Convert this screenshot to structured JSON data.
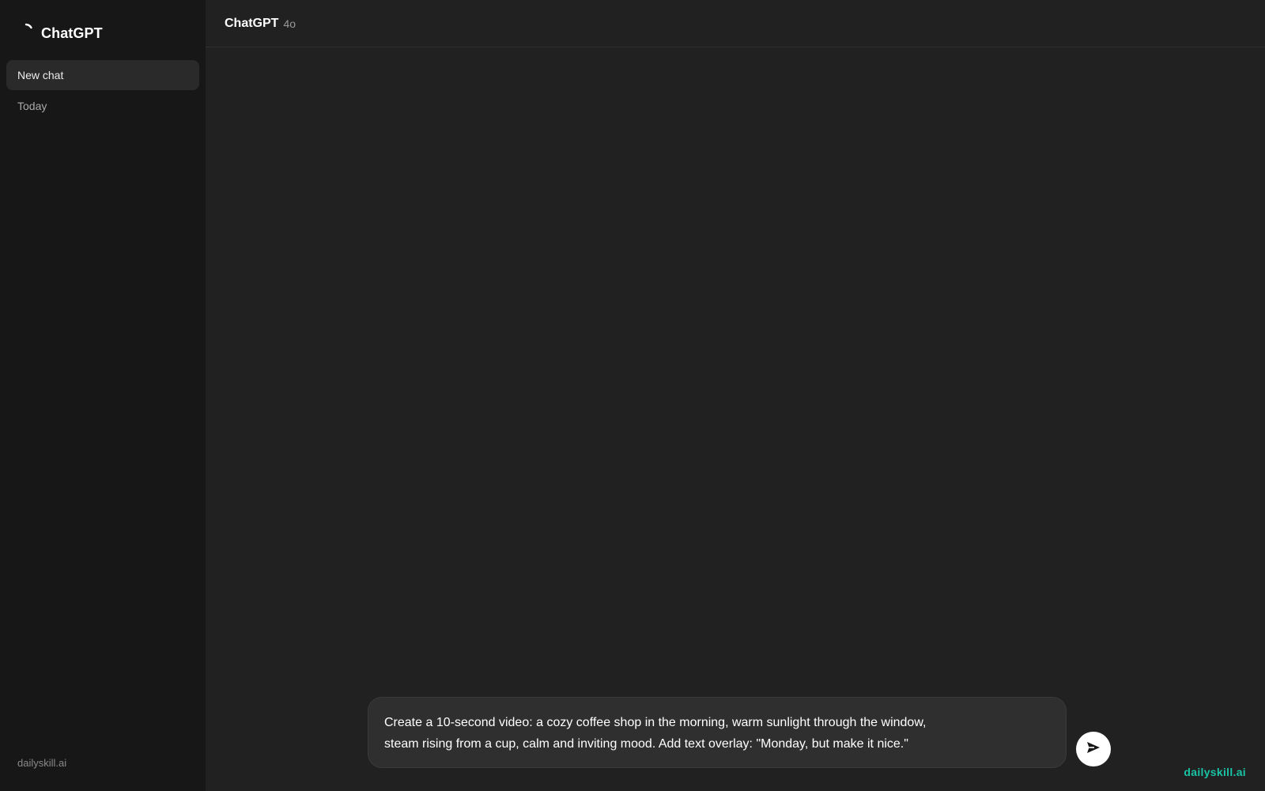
{
  "sidebar": {
    "brand": "ChatGPT",
    "logo_icon": "loading-spinner-icon",
    "new_chat_label": "New chat",
    "section_today": "Today",
    "footer": "dailyskill.ai"
  },
  "header": {
    "title": "ChatGPT",
    "version": "4o"
  },
  "composer": {
    "text": "Create a 10-second video: a cozy coffee shop in the morning, warm sunlight through the window,\nsteam rising from a cup, calm and inviting mood. Add text overlay: \"Monday, but make it nice.\"",
    "send_icon": "send-arrow-icon"
  },
  "watermark": "dailyskill.ai",
  "colors": {
    "sidebar_bg": "#171717",
    "main_bg": "#212121",
    "composer_bg": "#2f2f2f",
    "accent": "#19c3a5"
  }
}
